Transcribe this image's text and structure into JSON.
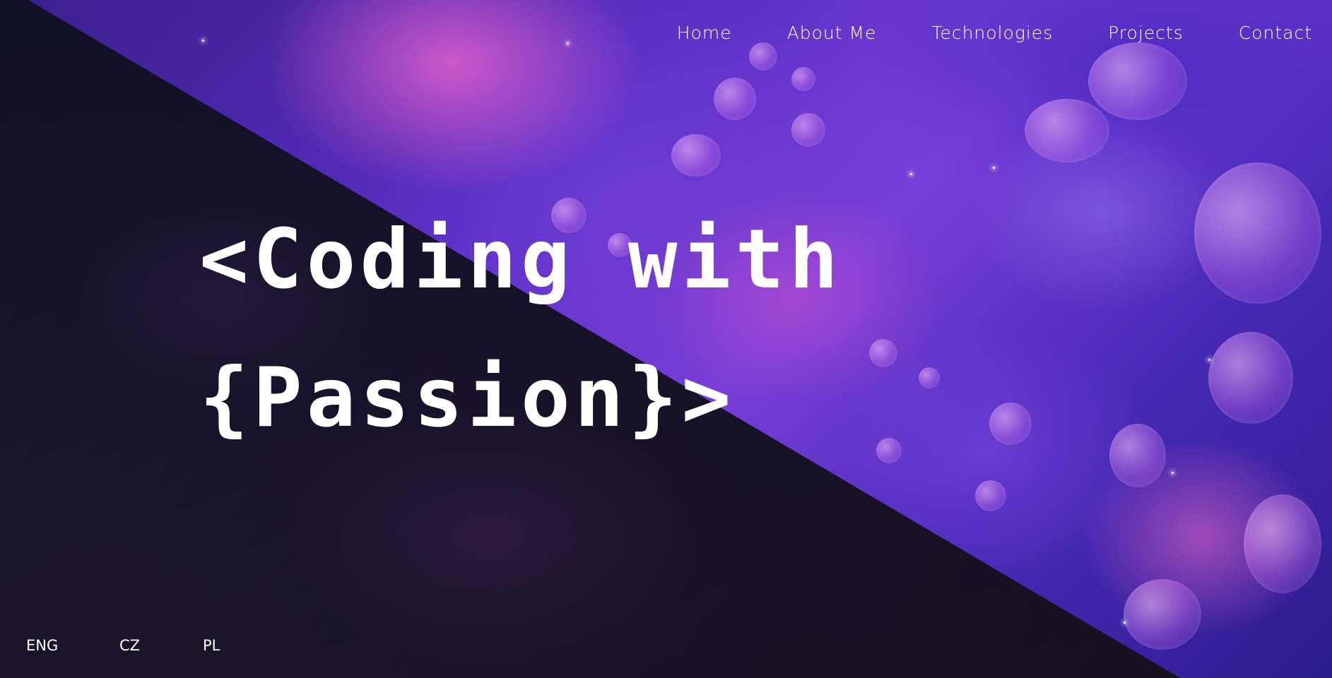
{
  "nav": {
    "items": [
      {
        "label": "Home"
      },
      {
        "label": "About Me"
      },
      {
        "label": "Technologies"
      },
      {
        "label": "Projects"
      },
      {
        "label": "Contact"
      }
    ]
  },
  "hero": {
    "line1": "<Coding with",
    "line2": "{Passion}>"
  },
  "languages": {
    "items": [
      {
        "label": "ENG"
      },
      {
        "label": "CZ"
      },
      {
        "label": "PL"
      }
    ]
  },
  "colors": {
    "text": "#ffffff",
    "dark_overlay": "#120e26",
    "nebula_purple": "#5a2fc4",
    "nebula_pink": "#e260ce"
  }
}
